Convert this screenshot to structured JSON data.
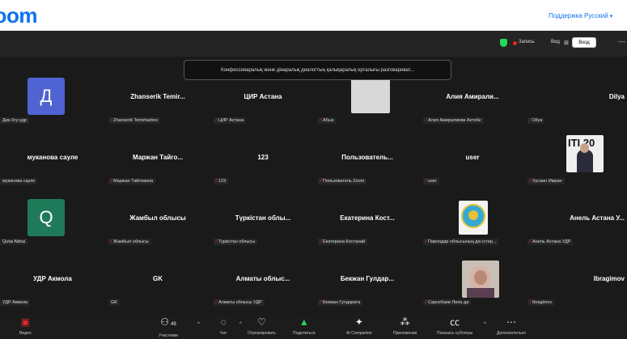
{
  "header": {
    "logo": "ɔom",
    "support": "Поддержка",
    "language": "Русский"
  },
  "meeting_bar": {
    "record_label": "Запись",
    "view_label": "Вид",
    "grid_icon": "grid-icon",
    "enter_label": "Вход",
    "minimize": "—"
  },
  "banner": {
    "text": "Конфессияаралық және дінаралық диалогтың қалықаралық орталығы разговариват..."
  },
  "tiles": [
    {
      "name": "",
      "label": "Дин Кгу-удр",
      "mic": false
    },
    {
      "name": "Zhanserik Temir...",
      "label": "Zhanserik Temirtashev",
      "mic": true
    },
    {
      "name": "ЦИР Астана",
      "label": "ЦИР Астана",
      "mic": true
    },
    {
      "name": "",
      "label": "Абыз",
      "mic": true
    },
    {
      "name": "Алия Амирали...",
      "label": "Алия Амиралиева Актобе",
      "mic": true
    },
    {
      "name": "Dilya",
      "label": "Dilya",
      "mic": true
    },
    {
      "name": "муканова сауле",
      "label": "муканова сауле",
      "mic": false
    },
    {
      "name": "Маржан Тайго...",
      "label": "Маржан Тайгожина",
      "mic": true
    },
    {
      "name": "123",
      "label": "123",
      "mic": true
    },
    {
      "name": "Пользователь...",
      "label": "Пользователь Zoom",
      "mic": true
    },
    {
      "name": "user",
      "label": "user",
      "mic": true
    },
    {
      "name": "",
      "label": "Хусаин Имран",
      "mic": true
    },
    {
      "name": "",
      "label": "Qutai Aitbai",
      "mic": false
    },
    {
      "name": "Жамбыл облысы",
      "label": "Жамбыл облысы",
      "mic": true
    },
    {
      "name": "Түркістан облы...",
      "label": "Туркістан облысы",
      "mic": true
    },
    {
      "name": "Екатерина Кост...",
      "label": "Екатерина Костанай",
      "mic": true
    },
    {
      "name": "",
      "label": "Павлодар облысының дін істер...",
      "mic": true
    },
    {
      "name": "Анель Астана У...",
      "label": "Анель Астана УДР",
      "mic": true
    },
    {
      "name": "УДР Акмола",
      "label": "УДР Акмола",
      "mic": false
    },
    {
      "name": "GK",
      "label": "GK",
      "mic": false
    },
    {
      "name": "Алматы облыс...",
      "label": "Алматы облысы УДР",
      "mic": true
    },
    {
      "name": "Бекжан Гулдар...",
      "label": "Бекжан Гулдарига",
      "mic": true
    },
    {
      "name": "",
      "label": "Сарсебаев Лила да",
      "mic": true
    },
    {
      "name": "Ibragimov",
      "label": "Ibragimov",
      "mic": true
    }
  ],
  "avatars": {
    "d_letter": "Д",
    "q_letter": "Q",
    "d_color": "#4f63d2",
    "q_color": "#1f7a5a"
  },
  "photo_text": {
    "banner_text": "ІТІ 20"
  },
  "toolbar": {
    "video": "Видео",
    "participants": "Участники",
    "participants_count": "49",
    "chat": "Чат",
    "reactions": "Отреагировать",
    "share": "Поделиться",
    "ai": "AI Companion",
    "apps": "Приложения",
    "captions": "Показать субтитры",
    "more": "Дополнительно"
  },
  "colors": {
    "accent": "#0e72ed",
    "share_green": "#23d959",
    "mic_red": "#e02828"
  }
}
